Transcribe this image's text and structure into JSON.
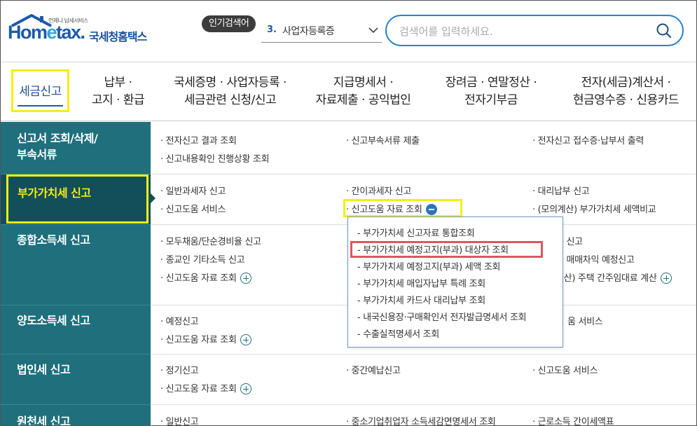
{
  "header": {
    "logo_tagline": "언제나 납세서비스",
    "logo_text_a": "Hom",
    "logo_text_e": "e",
    "logo_text_b": "tax.",
    "logo_kr": "국세청홈택스",
    "popular_badge": "인기검색어",
    "popular_rank": "3.",
    "popular_term": "사업자등록증",
    "search_placeholder": "검색어를 입력하세요."
  },
  "nav": {
    "items": [
      {
        "label": "세금신고"
      },
      {
        "label": "납부 ·\n고지 · 환급"
      },
      {
        "label": "국세증명 · 사업자등록 ·\n세금관련 신청/신고"
      },
      {
        "label": "지급명세서 ·\n자료제출 · 공익법인"
      },
      {
        "label": "장려금 · 연말정산 ·\n전자기부금"
      },
      {
        "label": "전자(세금)계산서 ·\n현금영수증 · 신용카드"
      }
    ]
  },
  "side": {
    "items": [
      {
        "label": "신고서 조회/삭제/\n부속서류"
      },
      {
        "label": "부가가치세 신고"
      },
      {
        "label": "종합소득세 신고"
      },
      {
        "label": "양도소득세 신고"
      },
      {
        "label": "법인세 신고"
      },
      {
        "label": "원천세 신고"
      }
    ]
  },
  "content": {
    "row1": {
      "c1": [
        "· 전자신고 결과 조회",
        "· 신고내용확인 진행상황 조회"
      ],
      "c2": [
        "· 신고부속서류 제출"
      ],
      "c3": [
        "· 전자신고 접수증·납부서 출력"
      ]
    },
    "row2": {
      "c1": [
        "· 일반과세자 신고",
        "· 신고도움 서비스"
      ],
      "c2": [
        "· 간이과세자 신고",
        "· 신고도움 자료 조회"
      ],
      "c3": [
        "· 대리납부 신고",
        "· (모의계산) 부가가치세 세액비교"
      ]
    },
    "row3": {
      "c1": [
        "· 모두채움/단순경비율 신고",
        "· 종교인 기타소득 신고",
        "· 신고도움 자료 조회"
      ],
      "c3": [
        "득 신고",
        "등 매매차익 예정신고",
        "계산) 주택 간주임대료 계산"
      ]
    },
    "row4": {
      "c1": [
        "· 예정신고",
        "· 신고도움 자료 조회"
      ],
      "c3": [
        "움 서비스"
      ]
    },
    "row5": {
      "c1": [
        "· 정기신고",
        "· 신고도움 자료 조회"
      ],
      "c2": [
        "· 중간예납신고"
      ],
      "c3": [
        "· 신고도움 서비스"
      ]
    },
    "row6": {
      "c1": [
        "· 일반신고"
      ],
      "c2": [
        "· 중소기업취업자 소득세감면명세서 조회"
      ],
      "c3": [
        "· 근로소득 간이세액표"
      ]
    }
  },
  "dropdown": {
    "items": [
      "- 부가가치세 신고자료 통합조회",
      "- 부가가치세 예정고지(부과) 대상자 조회",
      "- 부가가치세 예정고지(부과) 세액 조회",
      "- 부가가치세 매입자납부 특례 조회",
      "- 부가가치세 카드사 대리납부 조회",
      "- 내국신용장·구매확인서 전자발급명세서 조회",
      "- 수출실적명세서 조회"
    ]
  },
  "colors": {
    "brand_blue": "#1d5aa8",
    "side_bg": "#1f6f7d",
    "side_selected_bg": "#134f5a",
    "highlight_yellow": "#f5ef12",
    "highlight_red": "#e0555f",
    "search_border": "#2d82c8"
  }
}
